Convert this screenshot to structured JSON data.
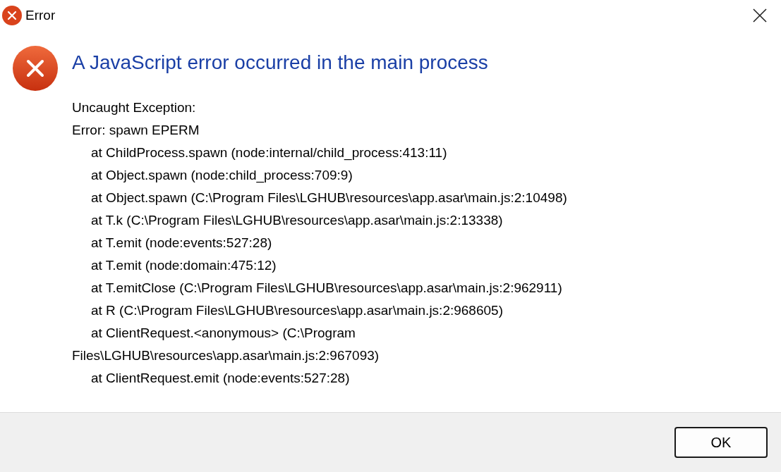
{
  "window": {
    "title": "Error"
  },
  "heading": "A JavaScript error occurred in the main process",
  "lines": [
    {
      "kind": "plain",
      "text": "Uncaught Exception:"
    },
    {
      "kind": "plain",
      "text": "Error: spawn EPERM"
    },
    {
      "kind": "indented",
      "text": "at ChildProcess.spawn (node:internal/child_process:413:11)"
    },
    {
      "kind": "indented",
      "text": "at Object.spawn (node:child_process:709:9)"
    },
    {
      "kind": "indented",
      "text": "at Object.spawn (C:\\Program Files\\LGHUB\\resources\\app.asar\\main.js:2:10498)"
    },
    {
      "kind": "indented",
      "text": "at T.k (C:\\Program Files\\LGHUB\\resources\\app.asar\\main.js:2:13338)"
    },
    {
      "kind": "indented",
      "text": "at T.emit (node:events:527:28)"
    },
    {
      "kind": "indented",
      "text": "at T.emit (node:domain:475:12)"
    },
    {
      "kind": "indented",
      "text": "at T.emitClose (C:\\Program Files\\LGHUB\\resources\\app.asar\\main.js:2:962911)"
    },
    {
      "kind": "indented",
      "text": "at R (C:\\Program Files\\LGHUB\\resources\\app.asar\\main.js:2:968605)"
    },
    {
      "kind": "indented",
      "text": "at ClientRequest.<anonymous> (C:\\Program"
    },
    {
      "kind": "plain",
      "text": "Files\\LGHUB\\resources\\app.asar\\main.js:2:967093)"
    },
    {
      "kind": "indented",
      "text": "at ClientRequest.emit (node:events:527:28)"
    }
  ],
  "buttons": [
    {
      "label": "OK",
      "selected": true
    }
  ]
}
